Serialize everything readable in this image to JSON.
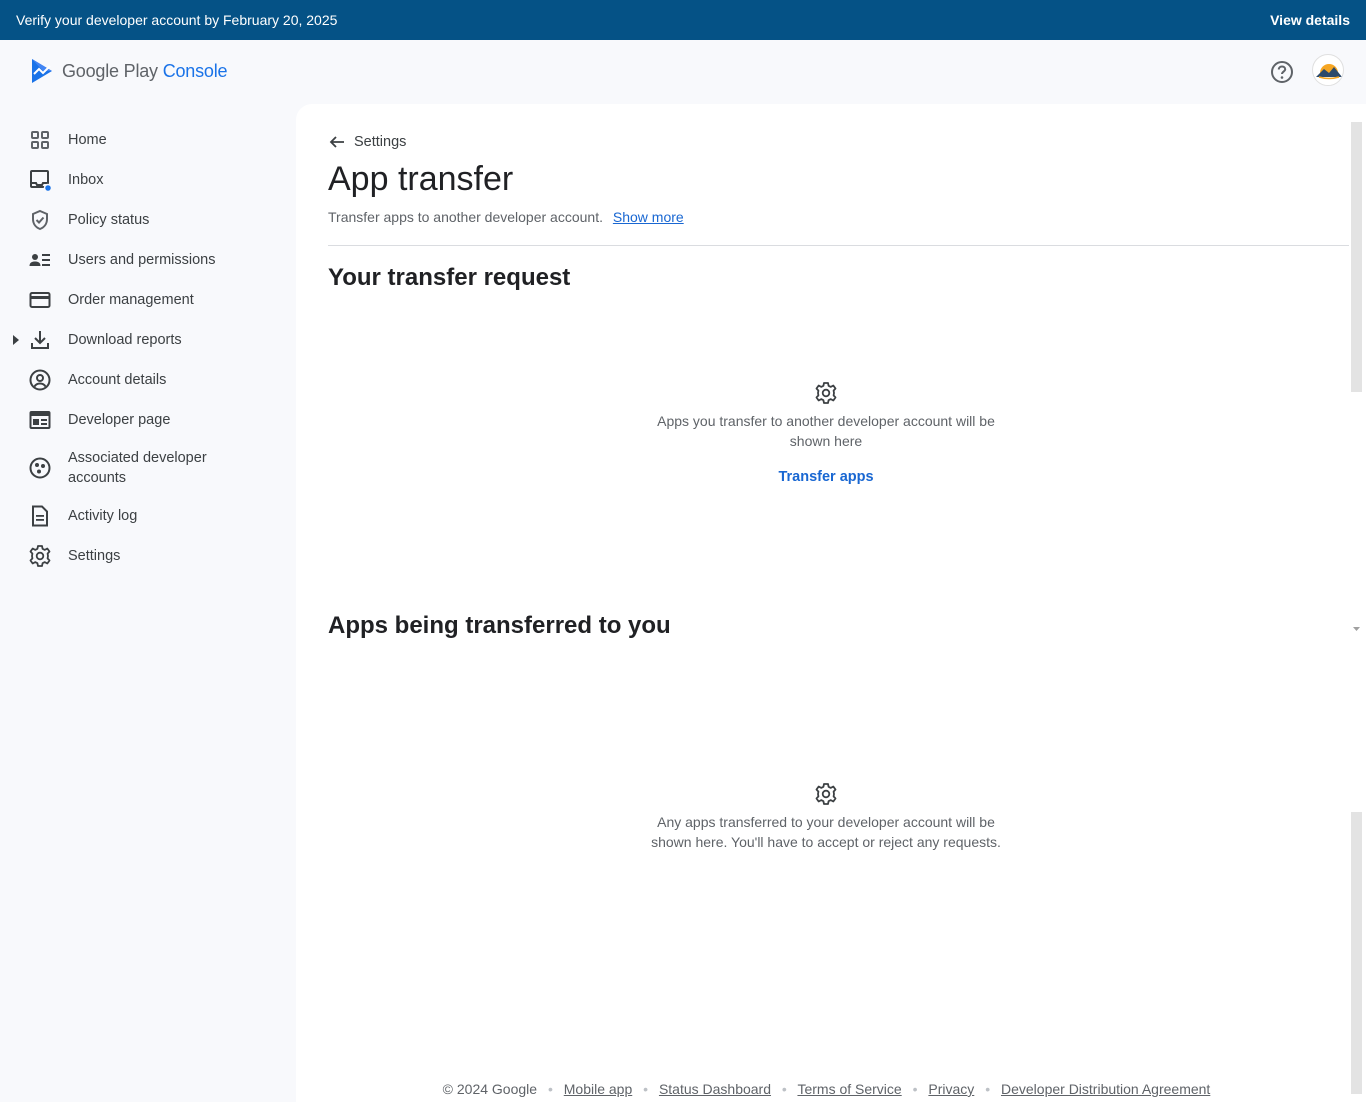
{
  "banner": {
    "message": "Verify your developer account by February 20, 2025",
    "link": "View details"
  },
  "header": {
    "logo_primary": "Google Play",
    "logo_accent": "Console",
    "help_icon": "help-circle-icon",
    "avatar_icon": "sunset-mountain-avatar"
  },
  "sidebar": {
    "items": [
      {
        "label": "Home",
        "icon": "dashboard-grid-icon"
      },
      {
        "label": "Inbox",
        "icon": "inbox-icon"
      },
      {
        "label": "Policy status",
        "icon": "shield-check-icon"
      },
      {
        "label": "Users and permissions",
        "icon": "people-list-icon"
      },
      {
        "label": "Order management",
        "icon": "credit-card-icon"
      },
      {
        "label": "Download reports",
        "icon": "download-icon"
      },
      {
        "label": "Account details",
        "icon": "account-circle-icon"
      },
      {
        "label": "Developer page",
        "icon": "web-page-icon"
      },
      {
        "label": "Associated developer accounts",
        "icon": "linked-accounts-icon"
      },
      {
        "label": "Activity log",
        "icon": "document-icon"
      },
      {
        "label": "Settings",
        "icon": "gear-icon"
      }
    ]
  },
  "main": {
    "back_label": "Settings",
    "title": "App transfer",
    "subtitle": "Transfer apps to another developer account.",
    "show_more": "Show more",
    "sections": [
      {
        "title": "Your transfer request",
        "empty_text": "Apps you transfer to another developer account will be shown here",
        "action": "Transfer apps"
      },
      {
        "title": "Apps being transferred to you",
        "empty_text": "Any apps transferred to your developer account will be shown here. You'll have to accept or reject any requests."
      }
    ]
  },
  "footer": {
    "copyright": "© 2024 Google",
    "links": [
      "Mobile app",
      "Status Dashboard",
      "Terms of Service",
      "Privacy",
      "Developer Distribution Agreement"
    ]
  },
  "colors": {
    "banner_bg": "#055286",
    "accent": "#1a73e8",
    "link": "#1967d2",
    "sidebar_bg": "#f8f9fc",
    "notification_dot": "#1a73e8"
  }
}
